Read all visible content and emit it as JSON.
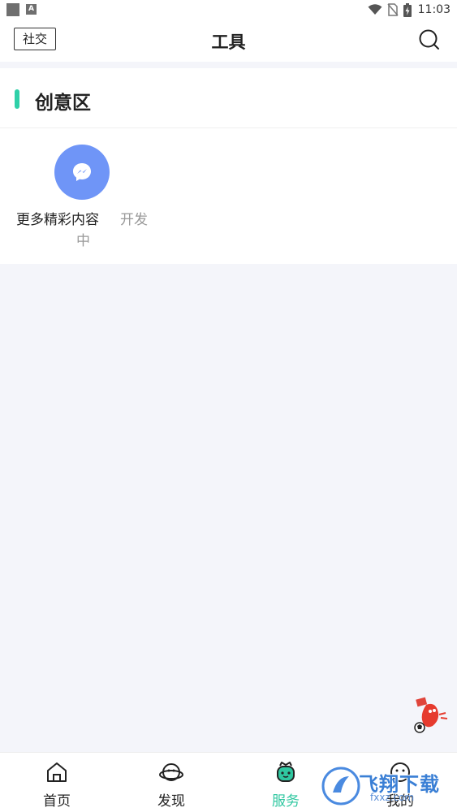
{
  "status_bar": {
    "time": "11:03",
    "notif_a": "A",
    "icons": [
      "notification-square-icon",
      "a-app-icon",
      "wifi-icon",
      "no-sim-icon",
      "battery-charging-icon"
    ]
  },
  "header": {
    "left_button": "社交",
    "title": "工具",
    "right_icon": "search-icon"
  },
  "section": {
    "title": "创意区",
    "accent_color": "#2fd0a8",
    "items": [
      {
        "label": "更多精彩内容",
        "status_line1": "开发",
        "status_line2": "中",
        "icon": "messenger-icon",
        "icon_bg": "#6f95f7"
      }
    ]
  },
  "bottom_nav": {
    "active_color": "#2fc7a0",
    "items": [
      {
        "label": "首页",
        "icon": "home-icon",
        "active": false
      },
      {
        "label": "发现",
        "icon": "planet-icon",
        "active": false
      },
      {
        "label": "服务",
        "icon": "robot-icon",
        "active": true
      },
      {
        "label": "我的",
        "icon": "smiley-icon",
        "active": false
      }
    ]
  },
  "watermark": {
    "text": "飞翔下载",
    "sub": "fxxz.com"
  }
}
